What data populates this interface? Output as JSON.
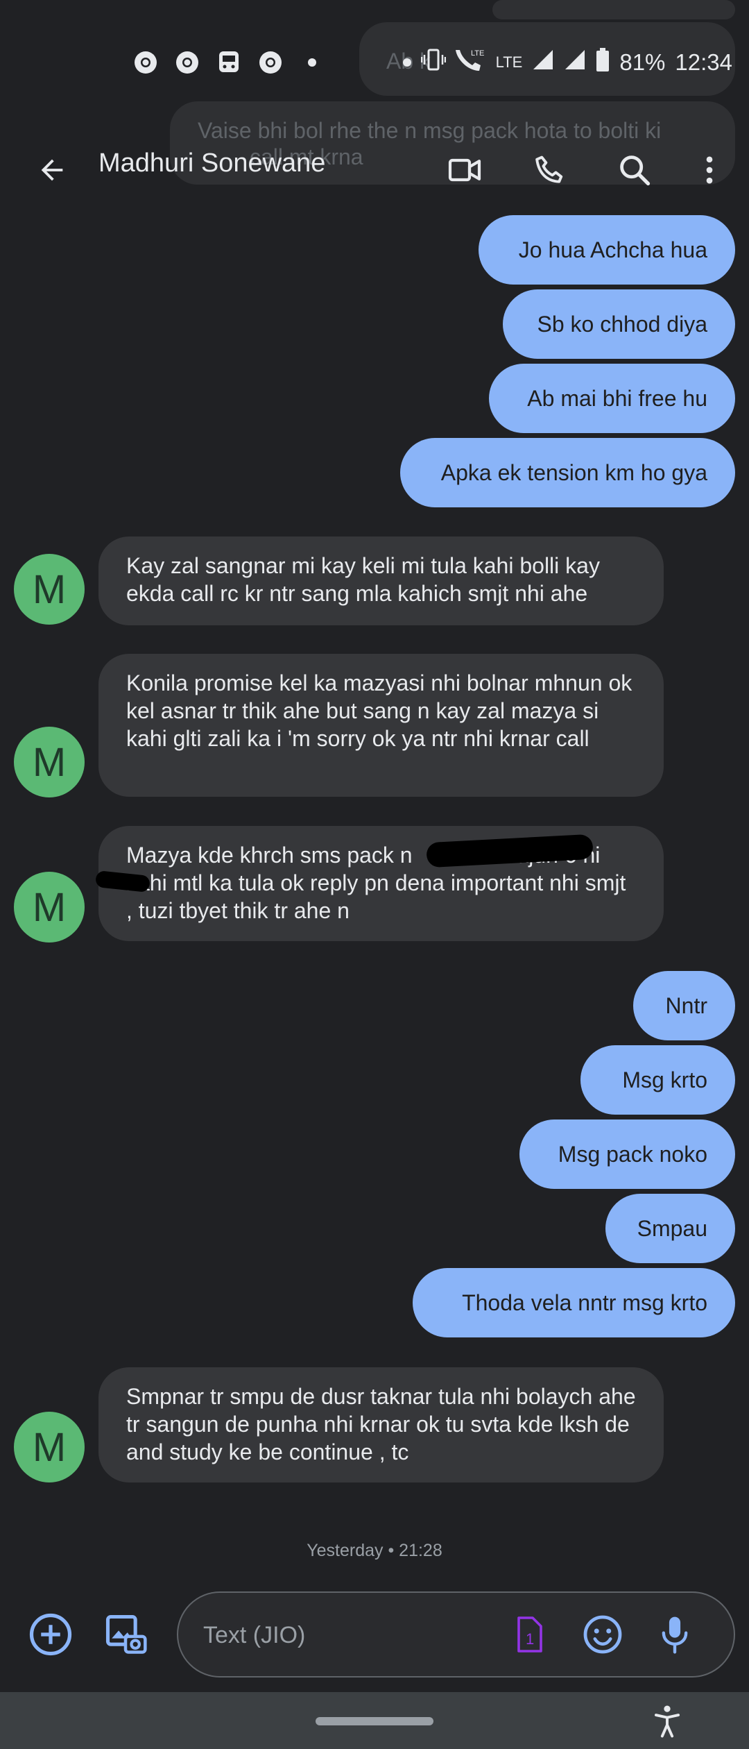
{
  "status_bar": {
    "battery": "81%",
    "time": "12:34",
    "network_1": "LTE",
    "network_2": "LTE",
    "left_icons": [
      "chrome-icon",
      "chrome-icon",
      "transit-icon",
      "chrome-icon",
      "dot-icon"
    ]
  },
  "background_preview": {
    "line1": "Ab k",
    "line2": "Vaise bhi bol rhe the n msg pack hota to bolti ki",
    "line3": "call mt krna"
  },
  "top_bar": {
    "contact_name": "Madhuri Sonewane",
    "icons": [
      "back-arrow-icon",
      "video-call-icon",
      "phone-icon",
      "search-icon",
      "more-vert-icon"
    ]
  },
  "conversation": {
    "avatar_initial": "M",
    "messages": [
      {
        "direction": "outgoing",
        "text": "Jo hua Achcha hua"
      },
      {
        "direction": "outgoing",
        "text": "Sb ko chhod diya"
      },
      {
        "direction": "outgoing",
        "text": "Ab mai bhi free hu"
      },
      {
        "direction": "outgoing",
        "text": "Apka ek tension km ho gya"
      },
      {
        "direction": "incoming",
        "text": "Kay zal sangnar mi kay keli mi tula kahi bolli kay ekda call rc kr ntr sang mla kahich smjt nhi ahe"
      },
      {
        "direction": "incoming",
        "text": "Konila promise kel ka mazyasi nhi bolnar mhnun ok kel asnar tr thik ahe but sang n kay zal mazya si kahi glti zali ka i 'm sorry ok ya ntr nhi krnar call"
      },
      {
        "direction": "incoming",
        "text": "Mazya kde khrch sms pack n                       ajun 6 ni kahi mtl ka tula ok reply pn dena important nhi smjt , tuzi tbyet thik tr ahe n"
      },
      {
        "direction": "outgoing",
        "text": "Nntr"
      },
      {
        "direction": "outgoing",
        "text": "Msg krto"
      },
      {
        "direction": "outgoing",
        "text": "Msg pack noko"
      },
      {
        "direction": "outgoing",
        "text": "Smpau"
      },
      {
        "direction": "outgoing",
        "text": "Thoda vela nntr msg krto"
      },
      {
        "direction": "incoming",
        "text": "Smpnar tr smpu de dusr taknar tula nhi bolaych ahe tr sangun de punha nhi krnar ok tu svta kde lksh de and study ke be continue , tc"
      }
    ],
    "timestamp": "Yesterday • 21:28"
  },
  "compose": {
    "placeholder": "Text (JIO)",
    "sim_label": "1",
    "icons": [
      "add-circle-icon",
      "gallery-icon",
      "sim-icon",
      "emoji-icon",
      "mic-icon"
    ]
  },
  "nav_bar": {
    "icons": [
      "home-handle-icon",
      "accessibility-icon"
    ]
  },
  "colors": {
    "background": "#202124",
    "outgoing_bubble": "#8ab4f8",
    "incoming_bubble": "#36373a",
    "avatar": "#5bb974",
    "accent": "#8ab4f8",
    "sim_icon": "#9334e6"
  }
}
